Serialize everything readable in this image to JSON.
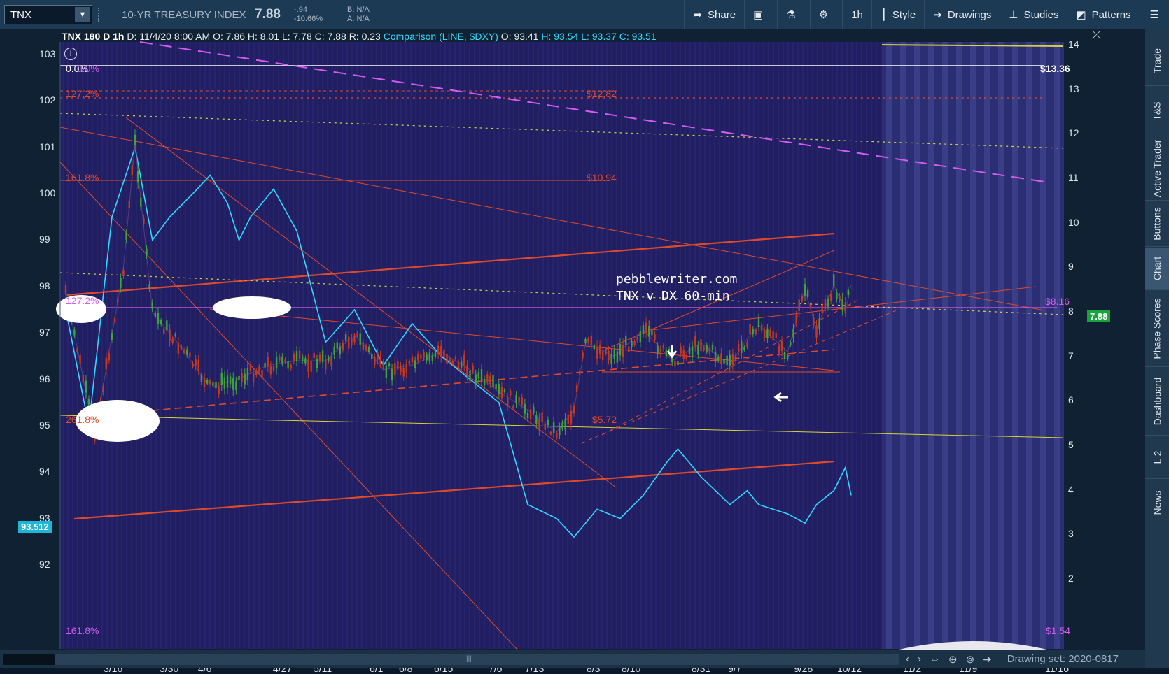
{
  "toolbar": {
    "symbol": "TNX",
    "description": "10-YR TREASURY INDEX",
    "last": "7.88",
    "change": "-.94",
    "change_pct": "-10.66%",
    "bid": "B: N/A",
    "ask": "A: N/A",
    "share": "Share",
    "timeframe": "1h",
    "style": "Style",
    "drawings": "Drawings",
    "studies": "Studies",
    "patterns": "Patterns"
  },
  "header": {
    "title": "TNX 180 D 1h",
    "date": "D: 11/4/20 8:00 AM",
    "open": "O: 7.86",
    "high": "H: 8.01",
    "low": "L: 7.78",
    "close": "C: 7.88",
    "range": "R: 0.23",
    "comparison": "Comparison (LINE, $DXY)",
    "c_open": "O: 93.41",
    "c_high": "H: 93.54",
    "c_low": "L: 93.37",
    "c_close": "C: 93.51"
  },
  "annotations": {
    "watermark_1": "pebblewriter.com",
    "watermark_2": "TNX v DX 60-min",
    "fib_0": "0.0%",
    "fib_1272_top": "127.2%",
    "fib_1618_top": "161.8%",
    "fib_1272_mid": "127.2%",
    "fib_2618": "261.8%",
    "fib_1618_bottom": "161.8%",
    "target_1282": "$12.82",
    "target_1094": "$10.94",
    "target_572": "$5.72",
    "target_1336": "$13.36",
    "target_816": "$8.16",
    "target_154": "$1.54"
  },
  "price_tags": {
    "current": "7.88",
    "dxy": "93.512"
  },
  "colors": {
    "plot_bg": "#211e62",
    "future_bg": "#2b2e72",
    "price_up": "#3fa43a",
    "price_down": "#c8381f",
    "comparison": "#35d7ff",
    "trendline": "#e04a2a",
    "fib_magenta": "#d65cf0",
    "yellow": "#d7d23a",
    "current_tag": "#17a43a",
    "dxy_tag": "#1fb6d6"
  },
  "chart_data": {
    "type": "line",
    "left_axis": {
      "label": "",
      "ticks": [
        92,
        93,
        94,
        95,
        96,
        97,
        98,
        99,
        100,
        101,
        102,
        103
      ]
    },
    "right_axis": {
      "label": "",
      "ticks": [
        2,
        3,
        4,
        5,
        6,
        7,
        8,
        9,
        10,
        11,
        12,
        13,
        14
      ]
    },
    "x_ticks": [
      "3/16",
      "3/30",
      "4/6",
      "4/27",
      "5/11",
      "6/1",
      "6/8",
      "6/15",
      "7/6",
      "7/13",
      "8/3",
      "8/10",
      "8/31",
      "9/7",
      "9/28",
      "10/12",
      "11/2",
      "11/9",
      "11/16"
    ],
    "series": [
      {
        "name": "TNX",
        "axis": "right",
        "x": [
          0,
          5,
          10,
          12,
          15,
          20,
          25,
          30,
          35,
          40,
          45,
          50,
          55,
          60,
          65,
          70,
          75,
          80,
          85,
          88,
          90,
          95,
          100,
          105,
          110,
          115,
          118,
          120,
          125,
          128,
          130,
          133,
          135,
          136
        ],
        "values": [
          8.5,
          5.2,
          9.0,
          11.8,
          8.0,
          7.2,
          6.3,
          6.5,
          6.8,
          6.9,
          6.9,
          7.5,
          6.7,
          6.8,
          7.1,
          6.7,
          6.2,
          5.8,
          5.3,
          5.8,
          7.3,
          7.0,
          7.6,
          6.9,
          7.3,
          6.8,
          7.4,
          7.7,
          7.1,
          8.5,
          7.6,
          8.6,
          8.0,
          8.6
        ]
      },
      {
        "name": "$DXY",
        "axis": "left",
        "x": [
          0,
          4,
          8,
          12,
          15,
          18,
          22,
          25,
          28,
          30,
          32,
          36,
          40,
          45,
          50,
          55,
          60,
          65,
          70,
          75,
          80,
          85,
          88,
          92,
          96,
          100,
          104,
          106,
          110,
          115,
          118,
          120,
          125,
          128,
          130,
          133,
          135,
          136
        ],
        "values": [
          97.5,
          95.0,
          99.5,
          101.0,
          99.0,
          99.5,
          100.0,
          100.4,
          99.8,
          99.0,
          99.5,
          100.1,
          99.2,
          96.8,
          97.5,
          96.3,
          97.2,
          96.5,
          96.0,
          95.5,
          93.3,
          93.0,
          92.6,
          93.2,
          93.0,
          93.5,
          94.2,
          94.5,
          93.9,
          93.3,
          93.6,
          93.3,
          93.1,
          92.9,
          93.3,
          93.6,
          94.1,
          93.5
        ]
      }
    ],
    "levels": [
      {
        "label": "0.0%",
        "value": 13.36
      },
      {
        "label": "127.2%",
        "value": 12.82
      },
      {
        "label": "161.8%",
        "value": 10.94
      },
      {
        "label": "127.2%",
        "value": 8.16
      },
      {
        "label": "261.8%",
        "value": 5.72
      }
    ]
  }
}
